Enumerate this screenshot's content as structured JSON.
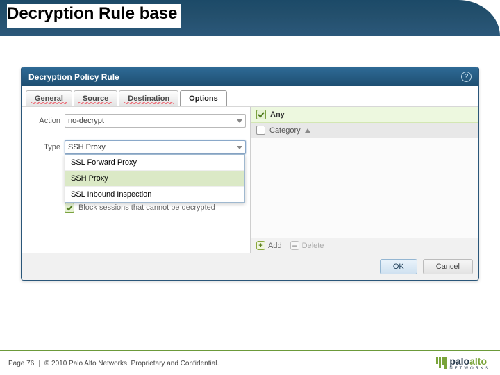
{
  "slide": {
    "title": "Decryption Rule base",
    "page_label": "Page 76",
    "copyright": "© 2010 Palo Alto Networks. Proprietary and Confidential.",
    "logo": {
      "word1": "palo",
      "word2": "alto",
      "sub": "NETWORKS"
    }
  },
  "dialog": {
    "title": "Decryption Policy Rule",
    "tabs": [
      "General",
      "Source",
      "Destination",
      "Options"
    ],
    "active_tab_index": 3,
    "left": {
      "action_label": "Action",
      "action_value": "no-decrypt",
      "type_label": "Type",
      "type_value": "SSH Proxy",
      "type_options": [
        "SSL Forward Proxy",
        "SSH Proxy",
        "SSL Inbound Inspection"
      ],
      "type_selected_index": 1,
      "block_label": "Block sessions that cannot be decrypted"
    },
    "right": {
      "any_label": "Any",
      "category_label": "Category",
      "add_label": "Add",
      "delete_label": "Delete"
    },
    "footer": {
      "ok": "OK",
      "cancel": "Cancel"
    }
  }
}
